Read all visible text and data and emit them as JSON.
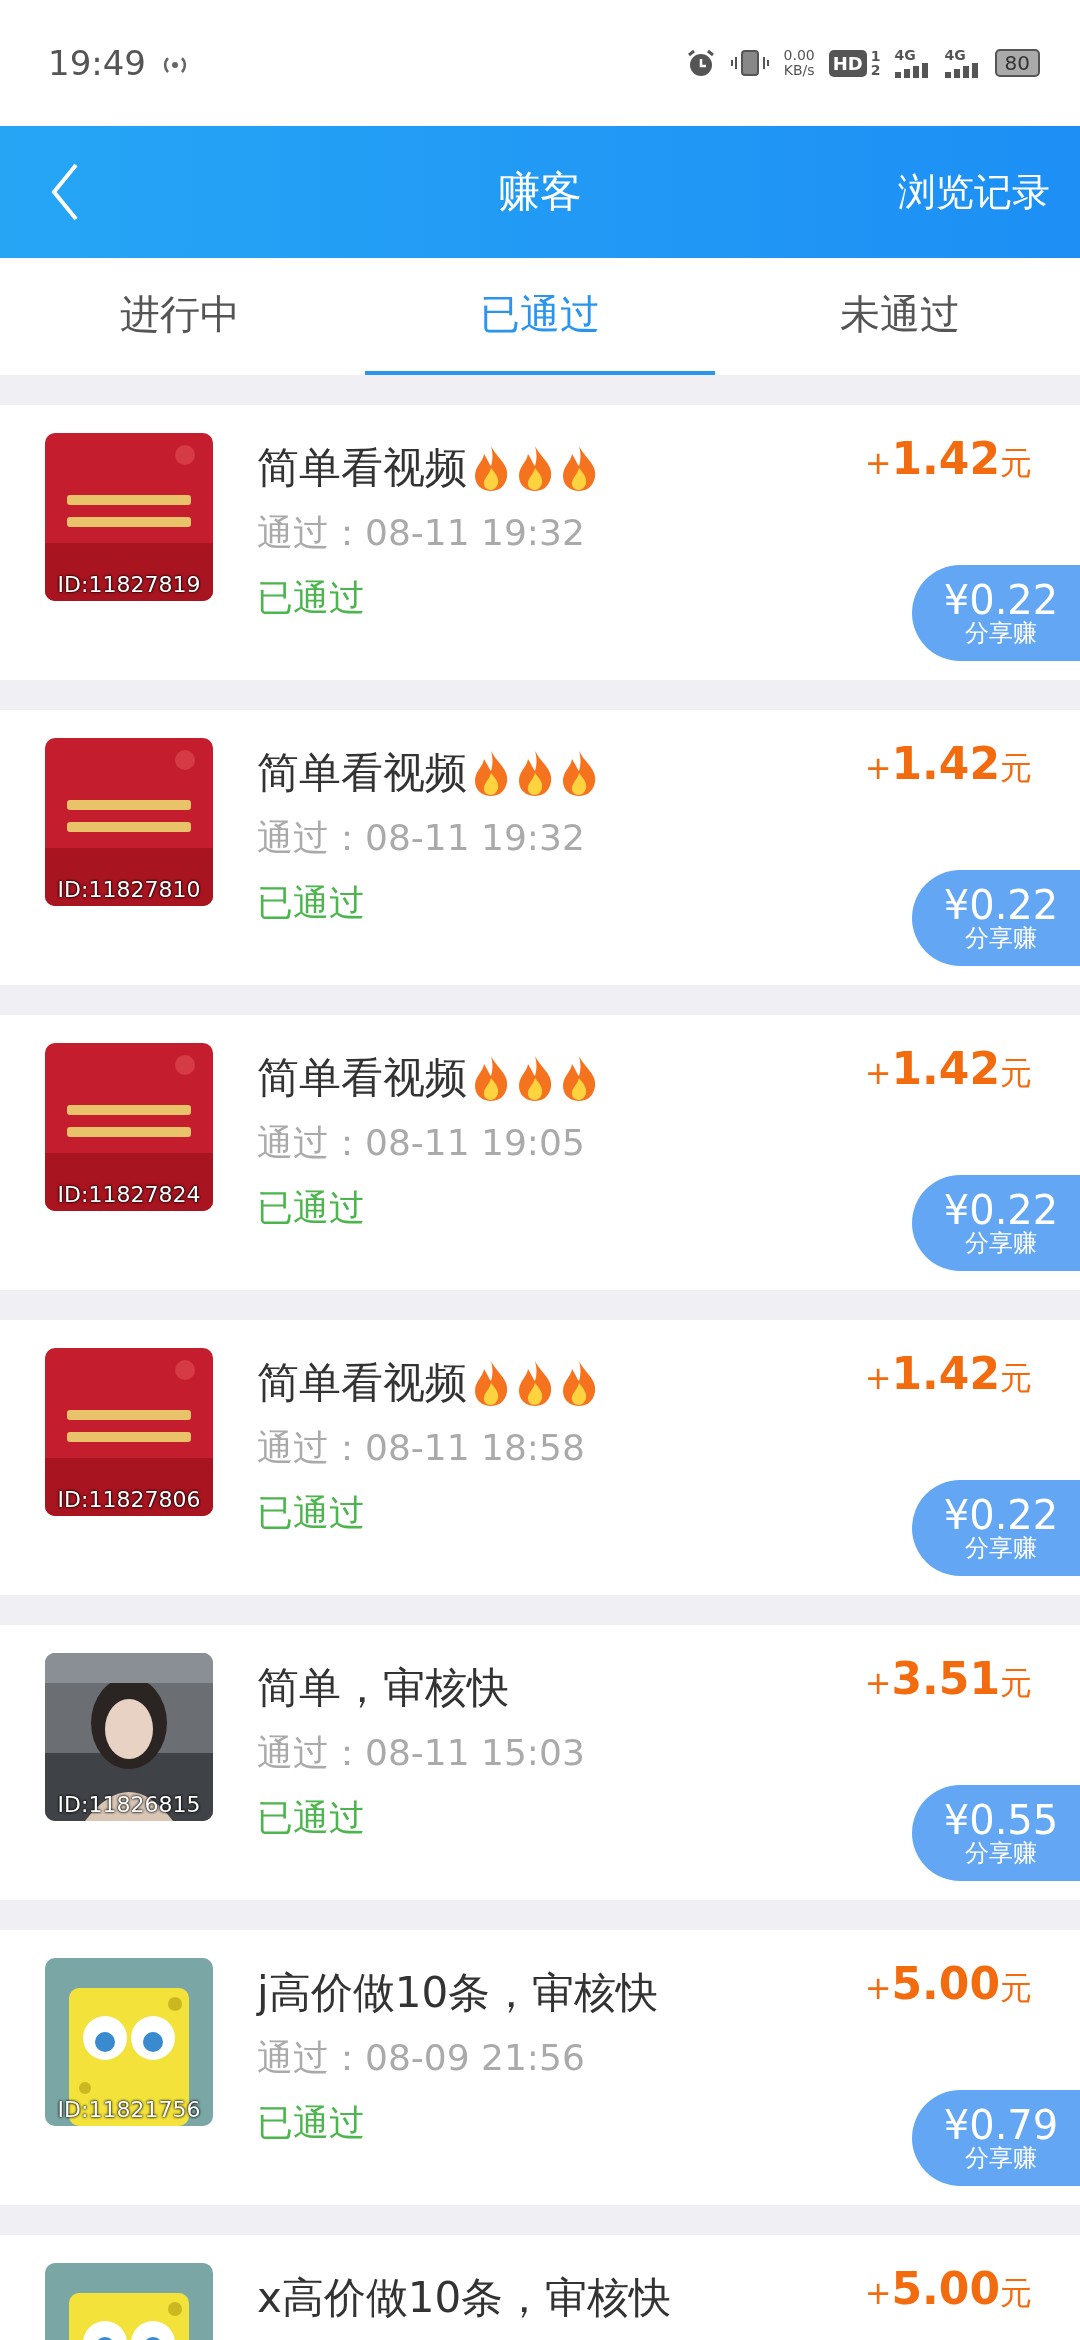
{
  "status_bar": {
    "time": "19:49",
    "speed": "0.00",
    "speed_unit": "KB/s",
    "hd": "HD",
    "sim_1": "1",
    "sim_2": "2",
    "network_1": "4G",
    "network_2": "4G",
    "battery": "80"
  },
  "header": {
    "title": "赚客",
    "action": "浏览记录"
  },
  "tabs": [
    {
      "label": "进行中",
      "selected": false
    },
    {
      "label": "已通过",
      "selected": true
    },
    {
      "label": "未通过",
      "selected": false
    }
  ],
  "tasks": [
    {
      "thumbnail": {
        "kind": "poster"
      },
      "id": "ID:11827819",
      "title": "简单看视频",
      "hot": true,
      "time": "通过：08-11 19:32",
      "status": "已通过",
      "plus": "+",
      "amount": "1.42",
      "unit": "元",
      "share_amount": "¥0.22",
      "share_label": "分享赚"
    },
    {
      "thumbnail": {
        "kind": "poster"
      },
      "id": "ID:11827810",
      "title": "简单看视频",
      "hot": true,
      "time": "通过：08-11 19:32",
      "status": "已通过",
      "plus": "+",
      "amount": "1.42",
      "unit": "元",
      "share_amount": "¥0.22",
      "share_label": "分享赚"
    },
    {
      "thumbnail": {
        "kind": "poster"
      },
      "id": "ID:11827824",
      "title": "简单看视频",
      "hot": true,
      "time": "通过：08-11 19:05",
      "status": "已通过",
      "plus": "+",
      "amount": "1.42",
      "unit": "元",
      "share_amount": "¥0.22",
      "share_label": "分享赚"
    },
    {
      "thumbnail": {
        "kind": "poster"
      },
      "id": "ID:11827806",
      "title": "简单看视频",
      "hot": true,
      "time": "通过：08-11 18:58",
      "status": "已通过",
      "plus": "+",
      "amount": "1.42",
      "unit": "元",
      "share_amount": "¥0.22",
      "share_label": "分享赚"
    },
    {
      "id": "ID:11826815",
      "title": "简单，审核快",
      "hot": false,
      "time": "通过：08-11 15:03",
      "status": "已通过",
      "plus": "+",
      "amount": "3.51",
      "unit": "元",
      "share_amount": "¥0.55",
      "share_label": "分享赚"
    },
    {
      "thumbnail": {
        "kind": "cartoon"
      },
      "id": "ID:11821756",
      "title": "j高价做10条，审核快",
      "hot": false,
      "time": "通过：08-09 21:56",
      "status": "已通过",
      "plus": "+",
      "amount": "5.00",
      "unit": "元",
      "share_amount": "¥0.79",
      "share_label": "分享赚"
    },
    {
      "thumbnail": {
        "kind": "cartoon"
      },
      "title": "x高价做10条，审核快",
      "hot": false,
      "plus": "+",
      "amount": "5.00",
      "unit": "元"
    }
  ]
}
